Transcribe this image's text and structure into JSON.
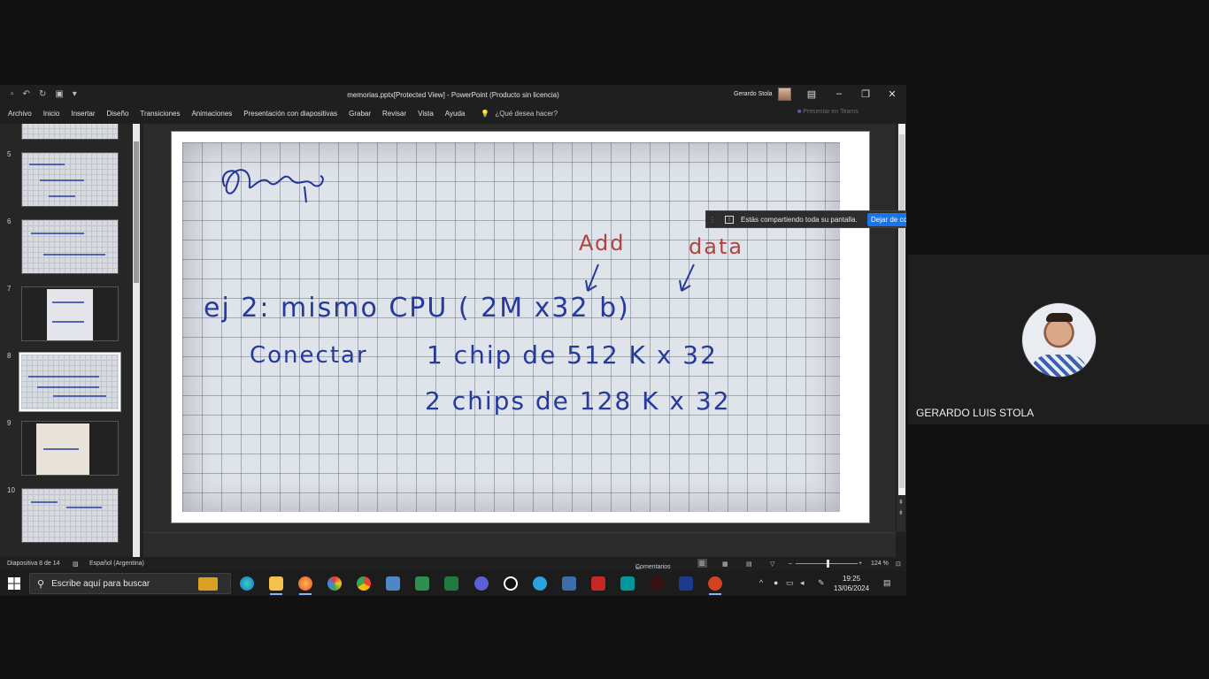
{
  "powerpoint": {
    "document_title": "memorias.pptx[Protected View]  -  PowerPoint (Producto sin licencia)",
    "user_name": "Gerardo Stola",
    "menu": [
      "Archivo",
      "Inicio",
      "Insertar",
      "Diseño",
      "Transiciones",
      "Animaciones",
      "Presentación con diapositivas",
      "Grabar",
      "Revisar",
      "Vista",
      "Ayuda"
    ],
    "tell_me": "¿Qué desea hacer?",
    "teams_present": "Presentar en Teams",
    "thumbnails": [
      {
        "num": "5"
      },
      {
        "num": "6"
      },
      {
        "num": "7"
      },
      {
        "num": "8"
      },
      {
        "num": "9"
      },
      {
        "num": "10"
      }
    ],
    "slide": {
      "label_add": "Add",
      "label_data": "data",
      "line1": "ej 2:  mismo CPU ( 2M x32 b)",
      "line2a": "Conectar",
      "line2b": "1  chip   de    512 K x 32",
      "line3": "2  chips  de   128 K  x 32"
    },
    "status": {
      "slide_info": "Diapositiva 8 de 14",
      "language": "Español (Argentina)",
      "comments": "Comentarios",
      "zoom": "124 %"
    }
  },
  "share_banner": {
    "text": "Estás compartiendo toda su pantalla.",
    "stop_label": "Dejar de compartir"
  },
  "taskbar": {
    "search_placeholder": "Escribe aquí para buscar",
    "time": "19:25",
    "date": "13/06/2024"
  },
  "participant": {
    "name": "GERARDO LUIS STOLA"
  }
}
